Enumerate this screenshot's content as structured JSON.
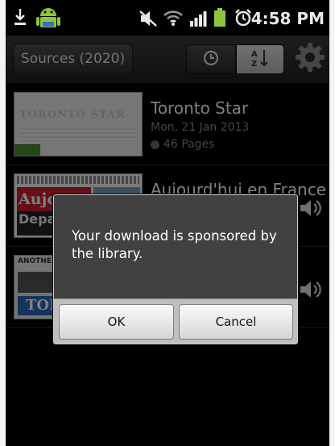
{
  "status_bar": {
    "time": "4:58 PM",
    "icons": [
      "download-icon",
      "android-icon",
      "mute-icon",
      "wifi-icon",
      "signal-icon",
      "battery-icon",
      "alarm-icon"
    ]
  },
  "toolbar": {
    "sources_label": "Sources (2020)",
    "sort_icons": [
      "clock-icon",
      "sort-az-icon"
    ],
    "settings_icon": "gear-icon"
  },
  "list": {
    "items": [
      {
        "title": "Toronto Star",
        "date": "Mon, 21 Jan 2013",
        "pages": "46 Pages",
        "thumb_text": "TORONTO STAR",
        "download_progress": 0.2
      },
      {
        "title": "Aujourd'hui en France",
        "thumb_text_top": "Aujo",
        "thumb_text_bottom": "Depa"
      },
      {
        "title": "",
        "thumb_text_top": "ANOTHE",
        "thumb_text_bottom": "TOR"
      }
    ]
  },
  "dialog": {
    "message": "Your download is sponsored by the library.",
    "ok_label": "OK",
    "cancel_label": "Cancel"
  },
  "colors": {
    "progress": "#4a8f2e",
    "dialog_bg": "#414141",
    "footer_bg": "#bfbfbf"
  }
}
